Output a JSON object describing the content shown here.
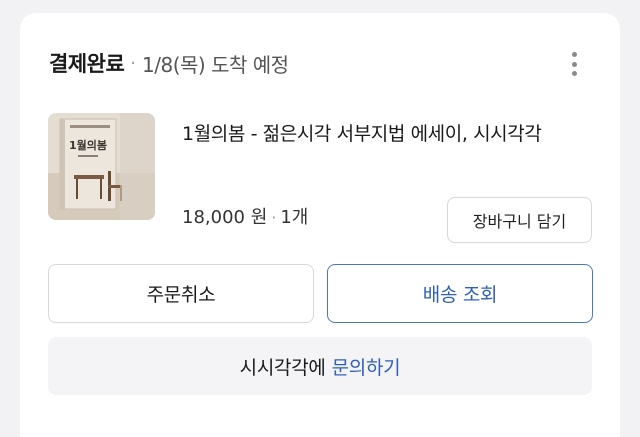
{
  "order": {
    "status": "결제완료",
    "separator": "·",
    "eta": "1/8(목) 도착 예정"
  },
  "more_menu": {
    "icon": "more-vertical-icon"
  },
  "product": {
    "cover_title": "1월의봄",
    "title": "1월의봄 - 젊은시각 서부지법 에세이, 시시각각",
    "price": "18,000 원",
    "separator": "·",
    "quantity": "1개"
  },
  "buttons": {
    "cart": "장바구니 담기",
    "cancel": "주문취소",
    "track": "배송 조회"
  },
  "inquiry": {
    "prefix": "시시각각에",
    "link": "문의하기"
  },
  "colors": {
    "accent": "#2f5fb8",
    "background": "#f2f2f4",
    "card": "#ffffff"
  }
}
